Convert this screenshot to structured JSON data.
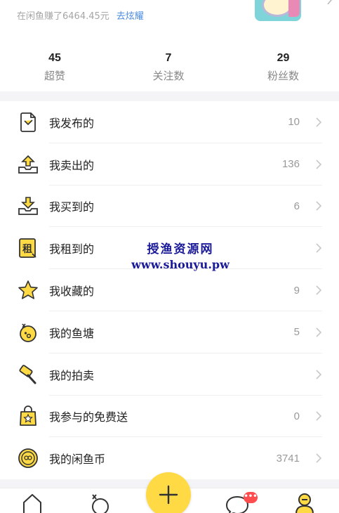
{
  "header": {
    "earnings_text": "在闲鱼赚了6464.45元",
    "show_off_link": "去炫耀"
  },
  "stats": [
    {
      "value": "45",
      "label": "超赞"
    },
    {
      "value": "7",
      "label": "关注数"
    },
    {
      "value": "29",
      "label": "粉丝数"
    }
  ],
  "menu": [
    {
      "label": "我发布的",
      "count": "10",
      "icon": "published-icon"
    },
    {
      "label": "我卖出的",
      "count": "136",
      "icon": "sold-icon"
    },
    {
      "label": "我买到的",
      "count": "6",
      "icon": "bought-icon"
    },
    {
      "label": "我租到的",
      "count": "",
      "icon": "rented-icon"
    },
    {
      "label": "我收藏的",
      "count": "9",
      "icon": "star-icon"
    },
    {
      "label": "我的鱼塘",
      "count": "5",
      "icon": "fishpond-icon"
    },
    {
      "label": "我的拍卖",
      "count": "",
      "icon": "auction-hammer-icon"
    },
    {
      "label": "我参与的免费送",
      "count": "0",
      "icon": "free-gift-icon"
    },
    {
      "label": "我的闲鱼币",
      "count": "3741",
      "icon": "coin-icon"
    }
  ],
  "rented_icon_char": "租",
  "watermark": {
    "line1": "授渔资源网",
    "line2": "www.shouyu.pw"
  },
  "tabbar": {
    "badge": "•••"
  },
  "colors": {
    "accent_yellow": "#ffda44",
    "link_blue": "#4a8be0",
    "badge_red": "#ff4d4f"
  }
}
